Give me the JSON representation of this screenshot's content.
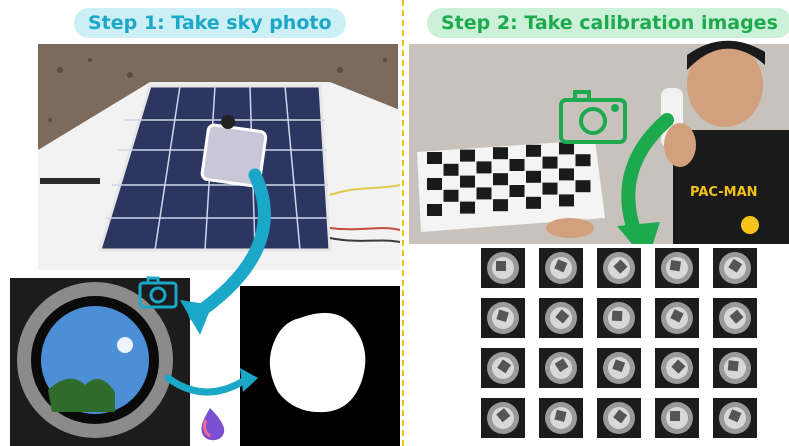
{
  "step1": {
    "title": "Step 1: Take sky photo"
  },
  "step2": {
    "title": "Step 2: Take calibration images"
  },
  "colors": {
    "cyan_accent": "#1ba7c7",
    "green_accent": "#1daa4e",
    "divider": "#f1c40f"
  },
  "icons": [
    "camera-icon",
    "arrow-icon",
    "water-drop-icon"
  ],
  "calibration_grid": {
    "rows": 4,
    "cols": 5
  }
}
